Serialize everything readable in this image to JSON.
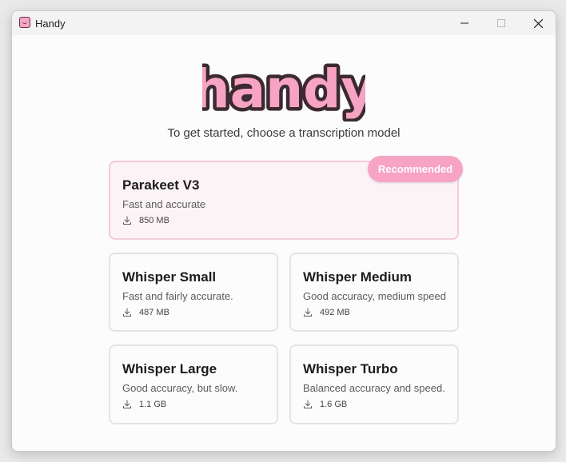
{
  "window": {
    "title": "Handy"
  },
  "logo": {
    "text": "handy"
  },
  "subtitle": "To get started, choose a transcription model",
  "badge": "Recommended",
  "models": [
    {
      "name": "Parakeet V3",
      "description": "Fast and accurate",
      "size": "850 MB"
    },
    {
      "name": "Whisper Small",
      "description": "Fast and fairly accurate.",
      "size": "487 MB"
    },
    {
      "name": "Whisper Medium",
      "description": "Good accuracy, medium speed",
      "size": "492 MB"
    },
    {
      "name": "Whisper Large",
      "description": "Good accuracy, but slow.",
      "size": "1.1 GB"
    },
    {
      "name": "Whisper Turbo",
      "description": "Balanced accuracy and speed.",
      "size": "1.6 GB"
    }
  ],
  "colors": {
    "accent": "#f7a3c4",
    "logo_outline": "#3b2a30",
    "featured_bg": "#fbf3f6"
  }
}
